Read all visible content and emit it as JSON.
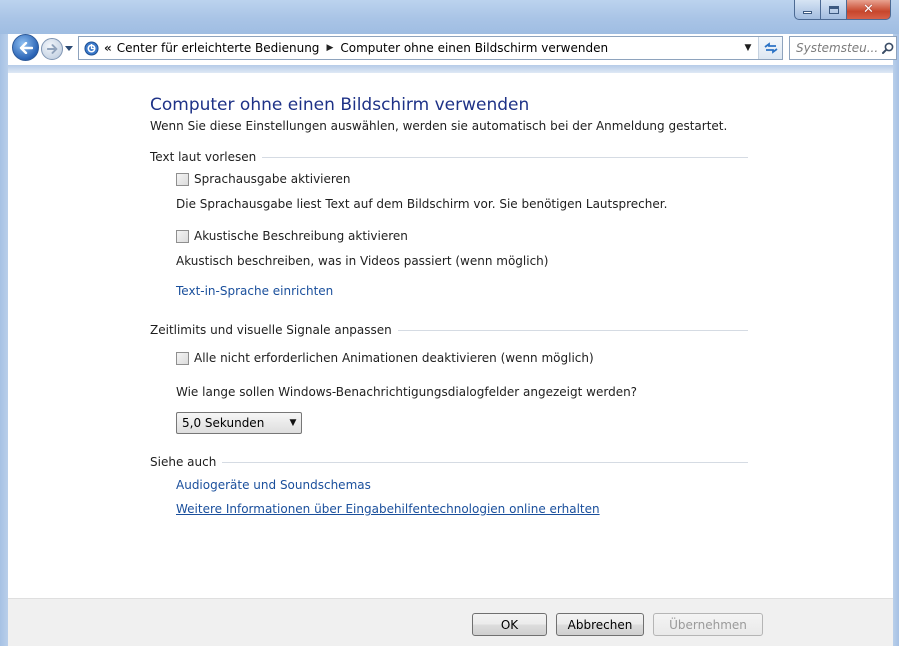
{
  "window": {
    "caption_buttons": {
      "minimize_icon": "minimize-icon",
      "maximize_icon": "maximize-icon",
      "close_icon": "close-icon",
      "close_glyph": "✕"
    }
  },
  "nav": {
    "back_icon": "back-arrow-icon",
    "forward_icon": "forward-arrow-icon",
    "history_icon": "chevron-down-icon"
  },
  "address": {
    "overflow": "«",
    "breadcrumbs": [
      "Center für erleichterte Bedienung",
      "Computer ohne einen Bildschirm verwenden"
    ],
    "separator": "▶",
    "dropdown": "▼"
  },
  "search": {
    "placeholder": "Systemsteu..."
  },
  "page": {
    "title": "Computer ohne einen Bildschirm verwenden",
    "subtitle": "Wenn Sie diese Einstellungen auswählen, werden sie automatisch bei der Anmeldung gestartet."
  },
  "sections": {
    "read_aloud": {
      "heading": "Text laut vorlesen",
      "narrator_checkbox": "Sprachausgabe aktivieren",
      "narrator_checked": false,
      "narrator_desc": "Die Sprachausgabe liest Text auf dem Bildschirm vor. Sie benötigen Lautsprecher.",
      "audio_desc_checkbox": "Akustische Beschreibung aktivieren",
      "audio_desc_checked": false,
      "audio_desc_desc": "Akustisch beschreiben, was in Videos passiert (wenn möglich)",
      "tts_link": "Text-in-Sprache einrichten"
    },
    "timing": {
      "heading": "Zeitlimits und visuelle Signale anpassen",
      "animations_checkbox": "Alle nicht erforderlichen Animationen deaktivieren (wenn möglich)",
      "animations_checked": false,
      "notification_question": "Wie lange sollen Windows-Benachrichtigungsdialogfelder angezeigt werden?",
      "notification_duration": "5,0 Sekunden"
    },
    "see_also": {
      "heading": "Siehe auch",
      "links": [
        "Audiogeräte und Soundschemas",
        "Weitere Informationen über Eingabehilfentechnologien online erhalten"
      ]
    }
  },
  "footer": {
    "ok": "OK",
    "cancel": "Abbrechen",
    "apply": "Übernehmen",
    "apply_enabled": false
  },
  "colors": {
    "title": "#1e3287",
    "link": "#1a4f9c",
    "frame": "#a9c4e6",
    "close_button": "#c7462c"
  }
}
